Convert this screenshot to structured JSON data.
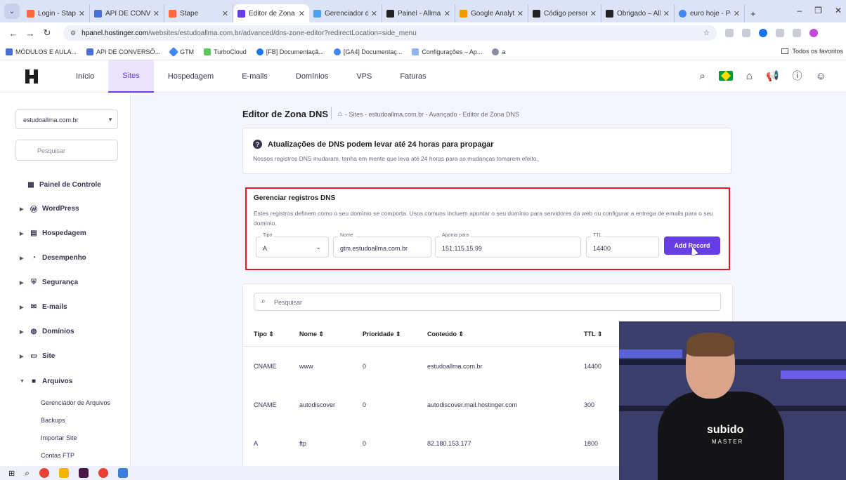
{
  "browser": {
    "tabs": [
      {
        "title": "Login - Stape",
        "color": "#ff6a3d"
      },
      {
        "title": "API DE CONVERSÃ",
        "color": "#4a6fd9"
      },
      {
        "title": "Stape",
        "color": "#ff6a3d"
      },
      {
        "title": "Editor de Zona D",
        "color": "#673de6"
      },
      {
        "title": "Gerenciador de s",
        "color": "#4aa3f0"
      },
      {
        "title": "Painel - Allma M",
        "color": "#222222"
      },
      {
        "title": "Google Analytics",
        "color": "#f29900"
      },
      {
        "title": "Código personali",
        "color": "#222222"
      },
      {
        "title": "Obrigado – Allm",
        "color": "#222222"
      },
      {
        "title": "euro hoje - Pesq",
        "color": "#4285f4"
      }
    ],
    "url_domain": "hpanel.hostinger.com",
    "url_path": "/websites/estudoallma.com.br/advanced/dns-zone-editor?redirectLocation=side_menu",
    "bookmarks": [
      "MÓDULOS E AULA...",
      "API DE CONVERSÕ...",
      "GTM",
      "TurboCloud",
      "[FB] Documentaçã...",
      "[GA4] Documentaç...",
      "Configurações – Ap...",
      "a"
    ],
    "bookmarks_right": "Todos os favoritos"
  },
  "header": {
    "nav": [
      "Início",
      "Sites",
      "Hospedagem",
      "E-mails",
      "Domínios",
      "VPS",
      "Faturas"
    ],
    "active": "Sites"
  },
  "sidebar": {
    "domain": "estudoallma.com.br",
    "search_placeholder": "Pesquisar",
    "items": [
      "Painel de Controle",
      "WordPress",
      "Hospedagem",
      "Desempenho",
      "Segurança",
      "E-mails",
      "Domínios",
      "Site",
      "Arquivos"
    ],
    "subitems": [
      "Gerenciador de Arquivos",
      "Backups",
      "Importar Site",
      "Contas FTP"
    ]
  },
  "page": {
    "title": "Editor de Zona DNS",
    "breadcrumb": "- Sites - estudoallma.com.br - Avançado - Editor de Zona DNS"
  },
  "notice": {
    "title": "Atualizações de DNS podem levar até 24 horas para propagar",
    "text": "Nossos registros DNS mudaram, tenha em mente que leva até 24 horas para as mudanças tomarem efeito."
  },
  "manage": {
    "title": "Gerenciar registros DNS",
    "text": "Estes registros definem como o seu domínio se comporta. Usos comuns incluem apontar o seu domínio para servidores da web ou configurar a entrega de emails para o seu domínio.",
    "type_label": "Tipo",
    "type_value": "A",
    "name_label": "Nome",
    "name_value": "gtm.estudoallma.com.br",
    "points_label": "Aponta para",
    "points_value": "151.115.15.99",
    "ttl_label": "TTL",
    "ttl_value": "14400",
    "add_button": "Add Record"
  },
  "table": {
    "search_placeholder": "Pesquisar",
    "headers": [
      "Tipo ⇕",
      "Nome ⇕",
      "Prioridade ⇕",
      "Conteúdo ⇕",
      "TTL ⇕"
    ],
    "rows": [
      [
        "CNAME",
        "www",
        "0",
        "estudoallma.com.br",
        "14400"
      ],
      [
        "CNAME",
        "autodiscover",
        "0",
        "autodiscover.mail.hostinger.com",
        "300"
      ],
      [
        "A",
        "ftp",
        "0",
        "82.180.153.177",
        "1800"
      ]
    ]
  },
  "webcam": {
    "shirt_line1": "subido",
    "shirt_line2": "MASTER"
  }
}
